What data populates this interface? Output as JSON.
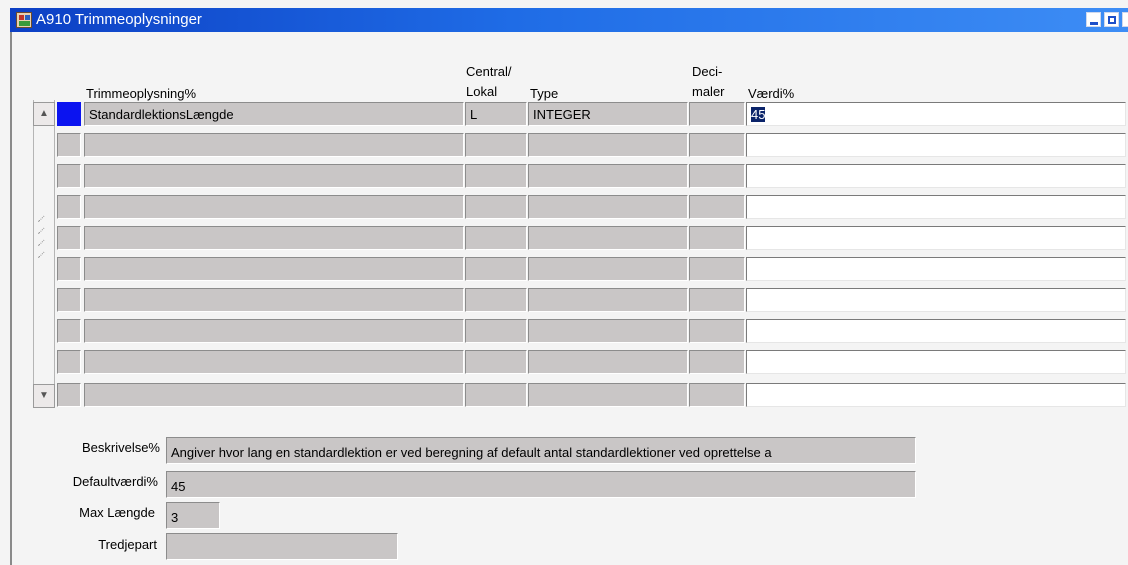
{
  "window": {
    "title": "A910 Trimmeoplysninger",
    "icon": "form-app-icon"
  },
  "columns": {
    "trimmeoplysning": "Trimmeoplysning%",
    "central_line1": "Central/",
    "central_line2": "Lokal",
    "type": "Type",
    "deci_line1": "Deci-",
    "deci_line2": "maler",
    "vaerdi": "Værdi%"
  },
  "rows": [
    {
      "name": "StandardlektionsLængde",
      "central": "L",
      "type": "INTEGER",
      "deci": "",
      "vaerdi": "45"
    },
    {
      "name": "",
      "central": "",
      "type": "",
      "deci": "",
      "vaerdi": ""
    },
    {
      "name": "",
      "central": "",
      "type": "",
      "deci": "",
      "vaerdi": ""
    },
    {
      "name": "",
      "central": "",
      "type": "",
      "deci": "",
      "vaerdi": ""
    },
    {
      "name": "",
      "central": "",
      "type": "",
      "deci": "",
      "vaerdi": ""
    },
    {
      "name": "",
      "central": "",
      "type": "",
      "deci": "",
      "vaerdi": ""
    },
    {
      "name": "",
      "central": "",
      "type": "",
      "deci": "",
      "vaerdi": ""
    },
    {
      "name": "",
      "central": "",
      "type": "",
      "deci": "",
      "vaerdi": ""
    },
    {
      "name": "",
      "central": "",
      "type": "",
      "deci": "",
      "vaerdi": ""
    },
    {
      "name": "",
      "central": "",
      "type": "",
      "deci": "",
      "vaerdi": ""
    }
  ],
  "details": {
    "beskrivelse_label": "Beskrivelse%",
    "beskrivelse_value": "Angiver hvor lang en standardlektion er ved beregning af default antal standardlektioner ved oprettelse a",
    "default_label": "Defaultværdi%",
    "default_value": "45",
    "maxlen_label": "Max Længde",
    "maxlen_value": "3",
    "tredjepart_label": "Tredjepart",
    "tredjepart_value": ""
  },
  "colors": {
    "title_bar": "#1f6ce6",
    "record_indicator": "#0b13f0",
    "field_gray": "#c9c6c6"
  }
}
